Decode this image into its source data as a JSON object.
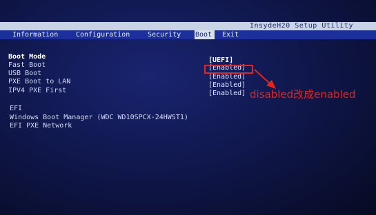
{
  "window": {
    "title": "InsydeH20 Setup Utility"
  },
  "menu": {
    "tabs": [
      {
        "label": "Information"
      },
      {
        "label": "Configuration"
      },
      {
        "label": "Security"
      },
      {
        "label": "Boot"
      },
      {
        "label": "Exit"
      }
    ],
    "active": "Boot"
  },
  "boot_settings": [
    {
      "label": "Boot Mode",
      "value": "[UEFI]"
    },
    {
      "label": "Fast Boot",
      "value": "[Enabled]"
    },
    {
      "label": "USB Boot",
      "value": "[Enabled]"
    },
    {
      "label": "PXE Boot to LAN",
      "value": "[Enabled]"
    },
    {
      "label": "IPV4 PXE First",
      "value": "[Enabled]"
    }
  ],
  "efi": {
    "header": "EFI",
    "items": [
      {
        "label": "Windows Boot Manager (WDC WD10SPCX-24HWST1)"
      },
      {
        "label": "EFI PXE Network"
      }
    ]
  },
  "annotation": {
    "text": "disabled改成enabled",
    "color": "#e0261e"
  },
  "colors": {
    "background": "#10184e",
    "menubar": "#1d2f9a",
    "titlebar": "#c9d3e6"
  }
}
